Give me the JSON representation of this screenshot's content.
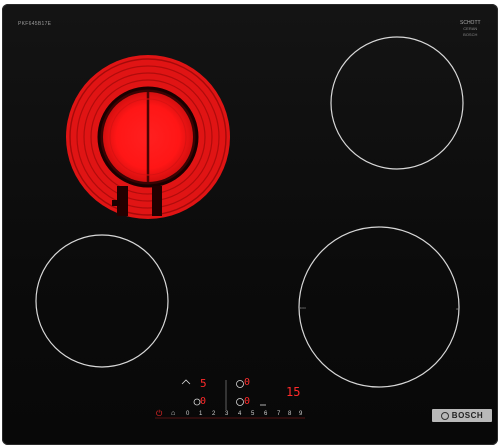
{
  "product": {
    "model_code": "PKF645B17E",
    "brand_mark": {
      "line1": "SCHOTT",
      "line2": "CERAN",
      "line3": "BOSCH"
    }
  },
  "hob": {
    "zones": [
      {
        "name": "front-left-dual-zone",
        "state": "on",
        "glow_color": "#ff1a1a"
      },
      {
        "name": "rear-right-zone",
        "state": "off"
      },
      {
        "name": "front-left-zone",
        "state": "off"
      },
      {
        "name": "front-right-zone",
        "state": "off"
      }
    ],
    "ring_marks": {
      "left": "ooo",
      "right": "o"
    }
  },
  "controls": {
    "display_zone_a_power": "5",
    "display_zone_a_right": "0",
    "display_zone_b_left": "0",
    "display_zone_b_right": "0",
    "timer_display": "15",
    "slider_scale": [
      "0",
      "1",
      "2",
      "3",
      "4",
      "5",
      "6",
      "7",
      "8",
      "9"
    ],
    "power_icon": "power-icon",
    "lock_icon": "lock-icon"
  },
  "badge": {
    "brand_name": "BOSCH"
  },
  "colors": {
    "glass": "#0b0b0b",
    "zone_outline": "#d8d8d8",
    "heat": "#ff1a1a",
    "display": "#ff2a2a",
    "badge": "#b9b9b9"
  }
}
